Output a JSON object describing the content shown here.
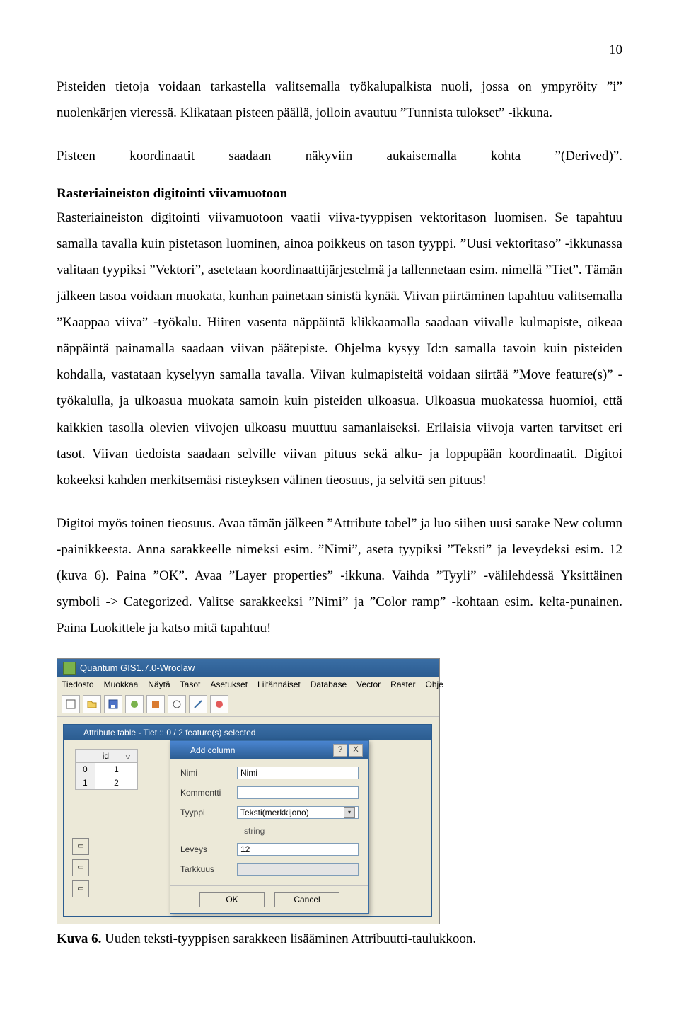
{
  "page_number": "10",
  "p1": "Pisteiden tietoja voidaan tarkastella valitsemalla työkalupalkista nuoli, jossa on ympyröity ”i” nuolenkärjen vieressä. Klikataan pisteen päällä, jolloin avautuu ”Tunnista tulokset” -ikkuna.",
  "derived_line": {
    "w1": "Pisteen",
    "w2": "koordinaatit",
    "w3": "saadaan",
    "w4": "näkyviin",
    "w5": "aukaisemalla",
    "w6": "kohta",
    "w7": "”(Derived)”."
  },
  "heading": "Rasteriaineiston digitointi viivamuotoon",
  "p2": "Rasteriaineiston digitointi viivamuotoon vaatii viiva-tyyppisen vektoritason luomisen. Se tapahtuu samalla tavalla kuin pistetason luominen, ainoa poikkeus on tason tyyppi. ”Uusi vektoritaso” -ikkunassa valitaan tyypiksi ”Vektori”, asetetaan koordinaattijärjestelmä ja tallennetaan esim. nimellä ”Tiet”. Tämän jälkeen tasoa voidaan muokata, kunhan painetaan sinistä kynää. Viivan piirtäminen tapahtuu valitsemalla ”Kaappaa viiva” -työkalu. Hiiren vasenta näppäintä klikkaamalla saadaan viivalle kulmapiste, oikeaa näppäintä painamalla saadaan viivan päätepiste. Ohjelma kysyy Id:n samalla tavoin kuin pisteiden kohdalla, vastataan kyselyyn samalla tavalla. Viivan kulmapisteitä voidaan siirtää ”Move feature(s)” -työkalulla, ja ulkoasua muokata samoin kuin pisteiden ulkoasua. Ulkoasua muokatessa huomioi, että kaikkien tasolla olevien viivojen ulkoasu muuttuu samanlaiseksi. Erilaisia viivoja varten tarvitset eri tasot. Viivan tiedoista saadaan selville viivan pituus sekä alku- ja loppupään koordinaatit. Digitoi kokeeksi kahden merkitsemäsi risteyksen välinen tieosuus, ja selvitä sen pituus!",
  "p3": "Digitoi myös toinen tieosuus. Avaa tämän jälkeen ”Attribute tabel” ja luo siihen uusi sarake New column -painikkeesta. Anna sarakkeelle nimeksi esim. ”Nimi”, aseta tyypiksi ”Teksti” ja leveydeksi esim. 12 (kuva 6). Paina ”OK”. Avaa ”Layer properties” -ikkuna. Vaihda ”Tyyli” -välilehdessä Yksittäinen symboli -> Categorized. Valitse sarakkeeksi ”Nimi” ja ”Color ramp” -kohtaan esim. kelta-punainen. Paina Luokittele ja katso mitä tapahtuu!",
  "qgis": {
    "title": "Quantum GIS1.7.0-Wroclaw",
    "menu": [
      "Tiedosto",
      "Muokkaa",
      "Näytä",
      "Tasot",
      "Asetukset",
      "Liitännäiset",
      "Database",
      "Vector",
      "Raster",
      "Ohje"
    ]
  },
  "attr_table": {
    "title": "Attribute table - Tiet :: 0 / 2 feature(s) selected",
    "header_id": "id",
    "rows": [
      {
        "idx": "0",
        "id": "1"
      },
      {
        "idx": "1",
        "id": "2"
      }
    ]
  },
  "dialog": {
    "title": "Add column",
    "labels": {
      "nimi": "Nimi",
      "kommentti": "Kommentti",
      "tyyppi": "Tyyppi",
      "leveys": "Leveys",
      "tarkkuus": "Tarkkuus"
    },
    "values": {
      "nimi": "Nimi",
      "kommentti": "",
      "tyyppi": "Teksti(merkkijono)",
      "string_hint": "string",
      "leveys": "12",
      "tarkkuus": ""
    },
    "buttons": {
      "ok": "OK",
      "cancel": "Cancel"
    },
    "help_x": "?",
    "close_x": "X"
  },
  "caption": {
    "label": "Kuva 6.",
    "text": " Uuden teksti-tyyppisen sarakkeen lisääminen Attribuutti-taulukkoon."
  }
}
